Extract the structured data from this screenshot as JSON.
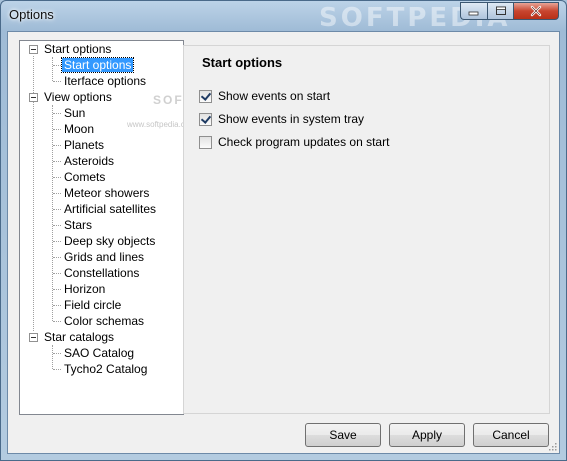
{
  "window": {
    "title": "Options",
    "watermark": "SOFTPEDIA"
  },
  "tree": {
    "watermark": "SOFTPEDIA",
    "watermark_sub": "www.softpedia.com",
    "groups": [
      {
        "label": "Start options",
        "children": [
          "Start options",
          "Iterface options"
        ]
      },
      {
        "label": "View options",
        "children": [
          "Sun",
          "Moon",
          "Planets",
          "Asteroids",
          "Comets",
          "Meteor showers",
          "Artificial satellites",
          "Stars",
          "Deep sky objects",
          "Grids and lines",
          "Constellations",
          "Horizon",
          "Field circle",
          "Color schemas"
        ]
      },
      {
        "label": "Star catalogs",
        "children": [
          "SAO Catalog",
          "Tycho2 Catalog"
        ]
      }
    ],
    "selected": "Start options"
  },
  "panel": {
    "title": "Start options",
    "options": [
      {
        "label": "Show events on start",
        "checked": true
      },
      {
        "label": "Show events in system tray",
        "checked": true
      },
      {
        "label": "Check program updates on start",
        "checked": false
      }
    ]
  },
  "buttons": {
    "save": "Save",
    "apply": "Apply",
    "cancel": "Cancel"
  },
  "colors": {
    "selection": "#3399ff",
    "close": "#c8452f",
    "title_bar": "#9fbbd6"
  }
}
